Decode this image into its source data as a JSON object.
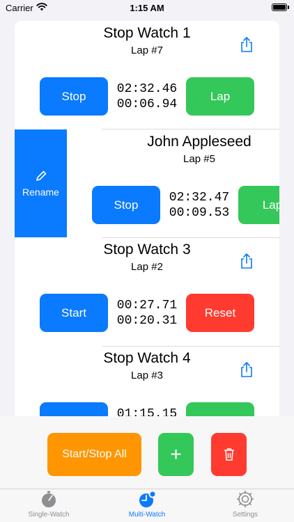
{
  "status_bar": {
    "carrier": "Carrier",
    "time": "1:15 AM"
  },
  "watches": [
    {
      "title": "Stop Watch 1",
      "lap": "Lap #7",
      "time_total": "02:32.46",
      "time_lap": "00:06.94",
      "left_button": "Stop",
      "right_button": "Lap"
    },
    {
      "title": "John Appleseed",
      "lap": "Lap #5",
      "time_total": "02:32.47",
      "time_lap": "00:09.53",
      "left_button": "Stop",
      "right_button": "Lap"
    },
    {
      "title": "Stop Watch 3",
      "lap": "Lap #2",
      "time_total": "00:27.71",
      "time_lap": "00:20.31",
      "left_button": "Start",
      "right_button": "Reset"
    },
    {
      "title": "Stop Watch 4",
      "lap": "Lap #3",
      "time_total": "01:15.15",
      "time_lap": "",
      "left_button": "",
      "right_button": ""
    }
  ],
  "swipe_action": {
    "label": "Rename"
  },
  "bottom": {
    "start_stop_all": "Start/Stop All",
    "add": "+"
  },
  "tabs": [
    {
      "label": "Single-Watch"
    },
    {
      "label": "Multi-Watch"
    },
    {
      "label": "Settings"
    }
  ],
  "colors": {
    "accent": "#0a7aff",
    "green": "#34c759",
    "red": "#ff3b30",
    "orange": "#ff9500"
  }
}
